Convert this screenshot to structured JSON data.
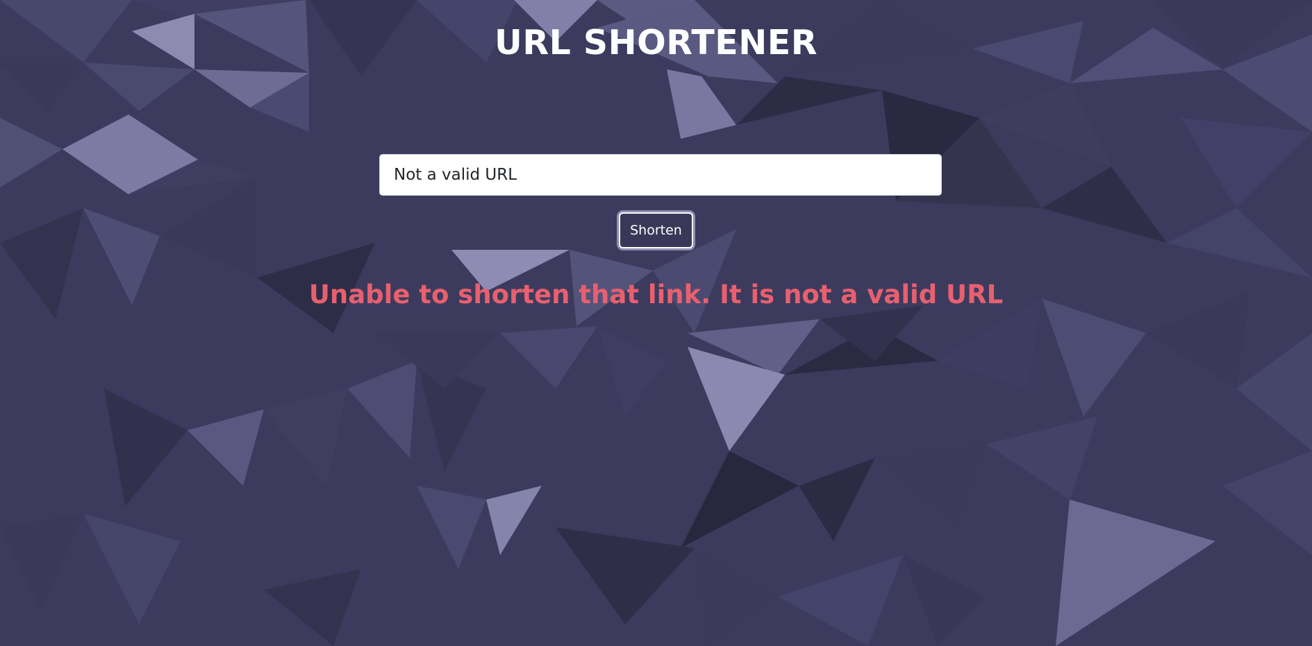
{
  "page": {
    "title": "URL SHORTENER"
  },
  "form": {
    "input_value": "Not a valid URL",
    "button_label": "Shorten"
  },
  "message": {
    "error_text": "Unable to shorten that link. It is not a valid URL"
  },
  "colors": {
    "error": "#e8606f",
    "background": "#3b3a5c",
    "button_bg": "#3a3858"
  },
  "icons": []
}
